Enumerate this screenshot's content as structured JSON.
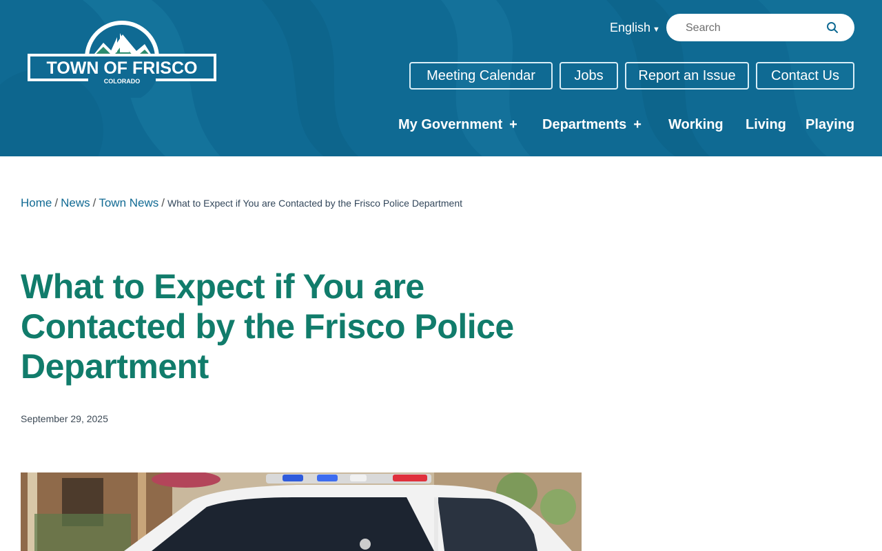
{
  "header": {
    "logo": {
      "town_text": "TOWN OF FRISCO",
      "state_text": "COLORADO"
    },
    "language": {
      "label": "English",
      "caret": "▼"
    },
    "search": {
      "placeholder": "Search",
      "icon": "search-icon"
    },
    "utility_links": [
      {
        "label": "Meeting Calendar"
      },
      {
        "label": "Jobs"
      },
      {
        "label": "Report an Issue"
      },
      {
        "label": "Contact Us"
      }
    ],
    "main_nav": [
      {
        "label": "My Government",
        "expander": "+"
      },
      {
        "label": "Departments",
        "expander": "+"
      },
      {
        "label": "Working"
      },
      {
        "label": "Living"
      },
      {
        "label": "Playing"
      }
    ],
    "colors": {
      "header_bg": "#0f6a93",
      "title": "#117c6b"
    }
  },
  "breadcrumb": {
    "items": [
      {
        "label": "Home"
      },
      {
        "label": "News"
      },
      {
        "label": "Town News"
      }
    ],
    "separator": "/",
    "current": "What to Expect if You are Contacted by the Frisco Police Department"
  },
  "article": {
    "title": "What to Expect if You are Contacted by the Frisco Police Department",
    "date": "September 29, 2025"
  }
}
